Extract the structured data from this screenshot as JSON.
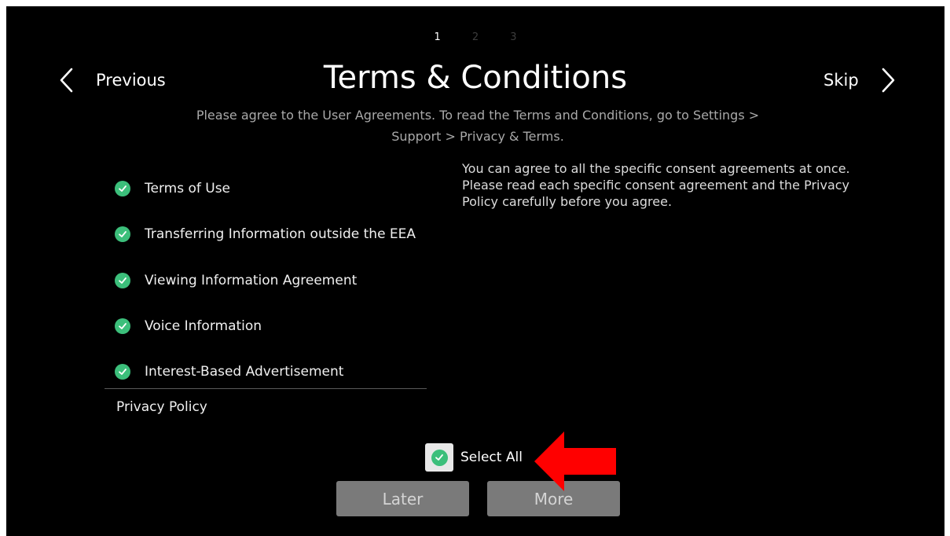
{
  "pagination": {
    "steps": [
      "1",
      "2",
      "3"
    ],
    "current": "1"
  },
  "header": {
    "previous_label": "Previous",
    "title": "Terms & Conditions",
    "skip_label": "Skip",
    "subtitle_line1": "Please agree to the User Agreements. To read the Terms and Conditions, go to Settings >",
    "subtitle_line2": "Support > Privacy & Terms."
  },
  "agreements": {
    "items": [
      {
        "label": "Terms of Use",
        "checked": true
      },
      {
        "label": "Transferring Information outside the EEA",
        "checked": true
      },
      {
        "label": "Viewing Information Agreement",
        "checked": true
      },
      {
        "label": "Voice Information",
        "checked": true
      },
      {
        "label": "Interest-Based Advertisement",
        "checked": true
      }
    ],
    "privacy_policy_label": "Privacy Policy"
  },
  "description": {
    "line1": "You can agree to all the specific consent agreements at once.",
    "line2": "Please read each specific consent agreement and the Privacy",
    "line3": "Policy carefully before you agree."
  },
  "select_all": {
    "label": "Select All",
    "checked": true
  },
  "buttons": {
    "later_label": "Later",
    "more_label": "More"
  },
  "icons": {
    "check": "check-circle-icon",
    "prev": "chevron-left-icon",
    "next": "chevron-right-icon",
    "annotation": "red-arrow-left-icon"
  },
  "colors": {
    "background": "#000000",
    "check_green": "#3cbf7b",
    "button_grey": "#7a7a7a",
    "annotation_red": "#ff0000"
  }
}
